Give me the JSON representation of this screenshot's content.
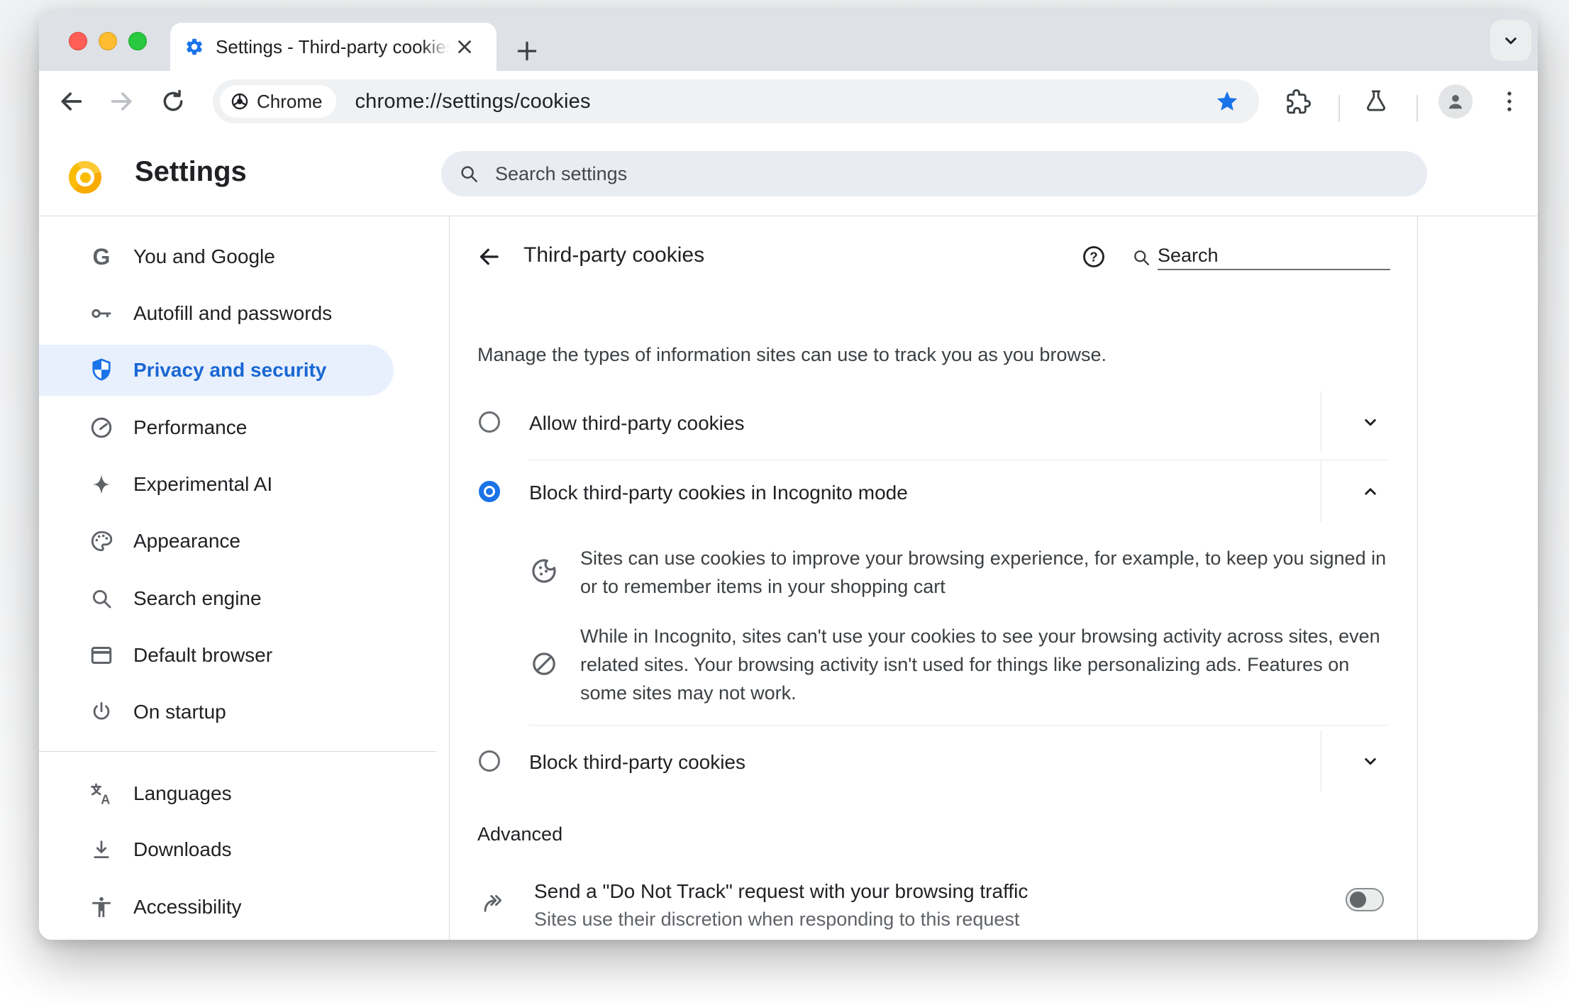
{
  "colors": {
    "accent_blue": "#1a73e8",
    "selected_item_text": "#1967d2",
    "selected_item_bg": "#e8f0fe",
    "text_primary": "#202124",
    "text_secondary": "#5f6368",
    "divider": "#dadce0",
    "tabstrip_bg": "#dee1e6",
    "omnibox_bg": "#eff1f3",
    "settings_search_bg": "#e9edf3",
    "traffic_red": "#ff5f57",
    "traffic_yellow": "#febc2e",
    "traffic_green": "#28c840"
  },
  "tab_strip": {
    "active_tab_title": "Settings - Third-party cookies",
    "favicon": "settings-gear-icon",
    "close_icon": "close-icon",
    "new_tab_icon": "plus-icon",
    "window_control_icon": "chevron-down-icon"
  },
  "toolbar": {
    "back_icon": "back-arrow-icon",
    "forward_icon": "forward-arrow-icon",
    "reload_icon": "reload-icon",
    "site_chip_label": "Chrome",
    "url": "chrome://settings/cookies",
    "bookmark_icon": "star-filled-icon",
    "extensions_icon": "puzzle-icon",
    "experiments_icon": "beaker-icon",
    "profile_icon": "avatar-icon",
    "menu_icon": "three-dot-menu-icon"
  },
  "settings_header": {
    "logo": "chrome-canary-logo",
    "title": "Settings",
    "search_placeholder": "Search settings"
  },
  "sidebar": {
    "items": [
      {
        "label": "You and Google",
        "icon": "google-g-icon",
        "selected": false
      },
      {
        "label": "Autofill and passwords",
        "icon": "key-icon",
        "selected": false
      },
      {
        "label": "Privacy and security",
        "icon": "shield-icon",
        "selected": true
      },
      {
        "label": "Performance",
        "icon": "speedometer-icon",
        "selected": false
      },
      {
        "label": "Experimental AI",
        "icon": "sparkle-icon",
        "selected": false
      },
      {
        "label": "Appearance",
        "icon": "palette-icon",
        "selected": false
      },
      {
        "label": "Search engine",
        "icon": "search-icon",
        "selected": false
      },
      {
        "label": "Default browser",
        "icon": "browser-window-icon",
        "selected": false
      },
      {
        "label": "On startup",
        "icon": "power-icon",
        "selected": false
      },
      {
        "label": "Languages",
        "icon": "translate-icon",
        "selected": false
      },
      {
        "label": "Downloads",
        "icon": "download-icon",
        "selected": false
      },
      {
        "label": "Accessibility",
        "icon": "accessibility-icon",
        "selected": false
      }
    ]
  },
  "content": {
    "title": "Third-party cookies",
    "help_icon": "help-circle-icon",
    "search_placeholder": "Search",
    "intro": "Manage the types of information sites can use to track you as you browse.",
    "options": [
      {
        "label": "Allow third-party cookies",
        "selected": false,
        "chevron": "down"
      },
      {
        "label": "Block third-party cookies in Incognito mode",
        "selected": true,
        "chevron": "up",
        "details": [
          {
            "icon": "cookie-icon",
            "text": "Sites can use cookies to improve your browsing experience, for example, to keep you signed in or to remember items in your shopping cart"
          },
          {
            "icon": "blocked-icon",
            "text": "While in Incognito, sites can't use your cookies to see your browsing activity across sites, even related sites. Your browsing activity isn't used for things like personalizing ads. Features on some sites may not work."
          }
        ]
      },
      {
        "label": "Block third-party cookies",
        "selected": false,
        "chevron": "down"
      }
    ],
    "advanced_label": "Advanced",
    "do_not_track": {
      "icon": "dnt-arrow-icon",
      "title": "Send a \"Do Not Track\" request with your browsing traffic",
      "subtitle": "Sites use their discretion when responding to this request",
      "enabled": false
    }
  }
}
